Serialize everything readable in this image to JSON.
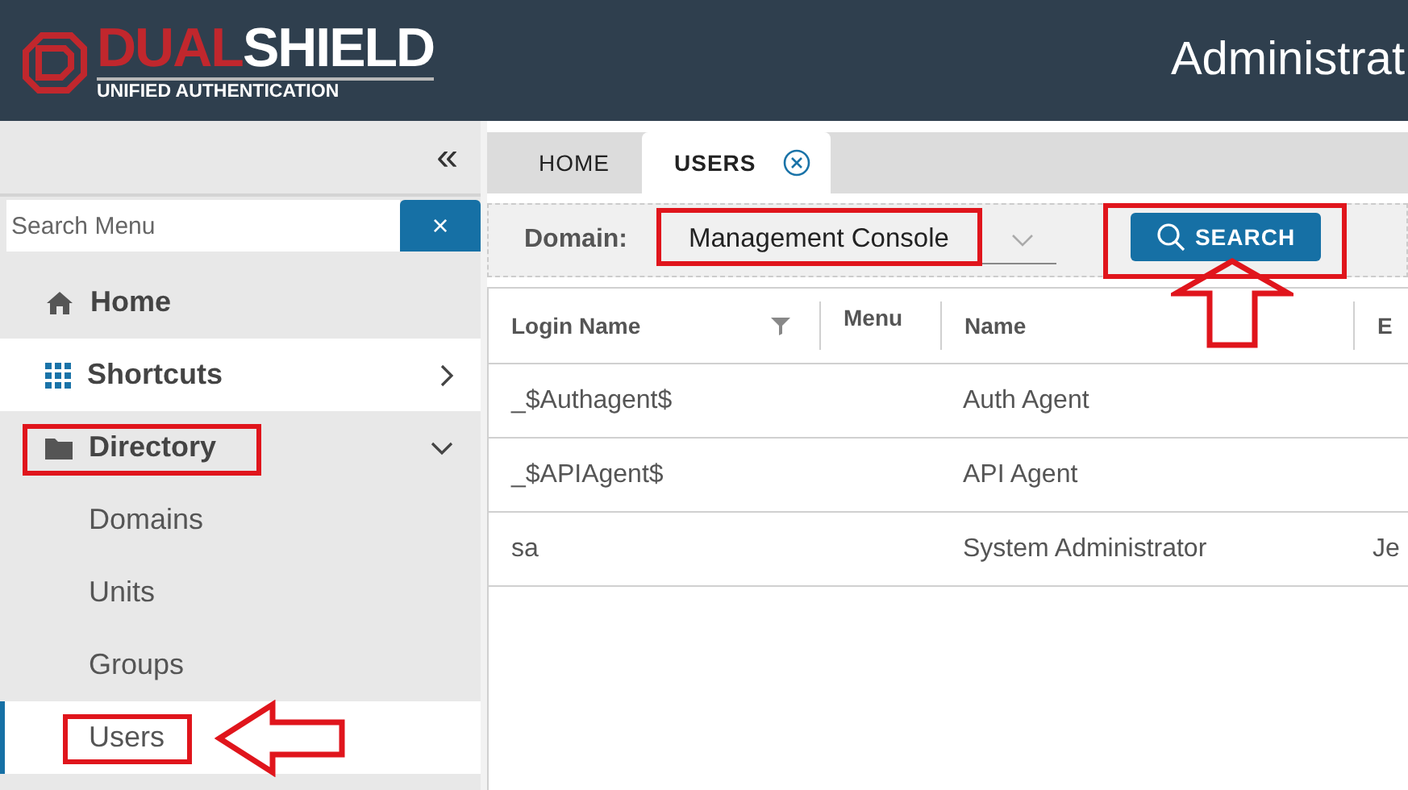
{
  "header": {
    "logo": {
      "part_1": "DUAL",
      "part_2": "SHIELD",
      "tagline": "UNIFIED AUTHENTICATION"
    },
    "title": "Administrat"
  },
  "sidebar": {
    "collapse": "«",
    "search": {
      "placeholder": "Search Menu",
      "clear": "×"
    },
    "items": [
      {
        "label": "Home",
        "kind": "home",
        "hovered": false,
        "highlighted": false
      },
      {
        "label": "Shortcuts",
        "kind": "shortcuts",
        "hovered": true,
        "highlighted": false,
        "expanded": false
      },
      {
        "label": "Directory",
        "kind": "folder",
        "hovered": false,
        "highlighted": true,
        "expanded": true,
        "children": [
          {
            "label": "Domains",
            "selected": false,
            "highlighted": false,
            "pointed_at": false
          },
          {
            "label": "Units",
            "selected": false,
            "highlighted": false,
            "pointed_at": false
          },
          {
            "label": "Groups",
            "selected": false,
            "highlighted": false,
            "pointed_at": false
          },
          {
            "label": "Users",
            "selected": true,
            "highlighted": true,
            "pointed_at": true
          }
        ]
      }
    ]
  },
  "tabs": [
    {
      "label": "HOME",
      "selected": false,
      "closable": false
    },
    {
      "label": "USERS",
      "selected": true,
      "closable": true
    }
  ],
  "toolbar": {
    "domain_label": "Domain:",
    "domain_value": "Management Console",
    "domain_highlighted": true,
    "search_button": "SEARCH",
    "search_highlighted": true,
    "search_pointed_at": true
  },
  "table": {
    "columns": [
      {
        "label": "Login Name",
        "filter": true
      },
      {
        "label": "Menu",
        "filter": false
      },
      {
        "label": "Name",
        "filter": false
      },
      {
        "label": "E",
        "filter": false
      }
    ],
    "rows": [
      [
        "_$Authagent$",
        "",
        "Auth Agent",
        ""
      ],
      [
        "_$APIAgent$",
        "",
        "API Agent",
        ""
      ],
      [
        "sa",
        "",
        "System Administrator",
        "Je"
      ]
    ]
  }
}
